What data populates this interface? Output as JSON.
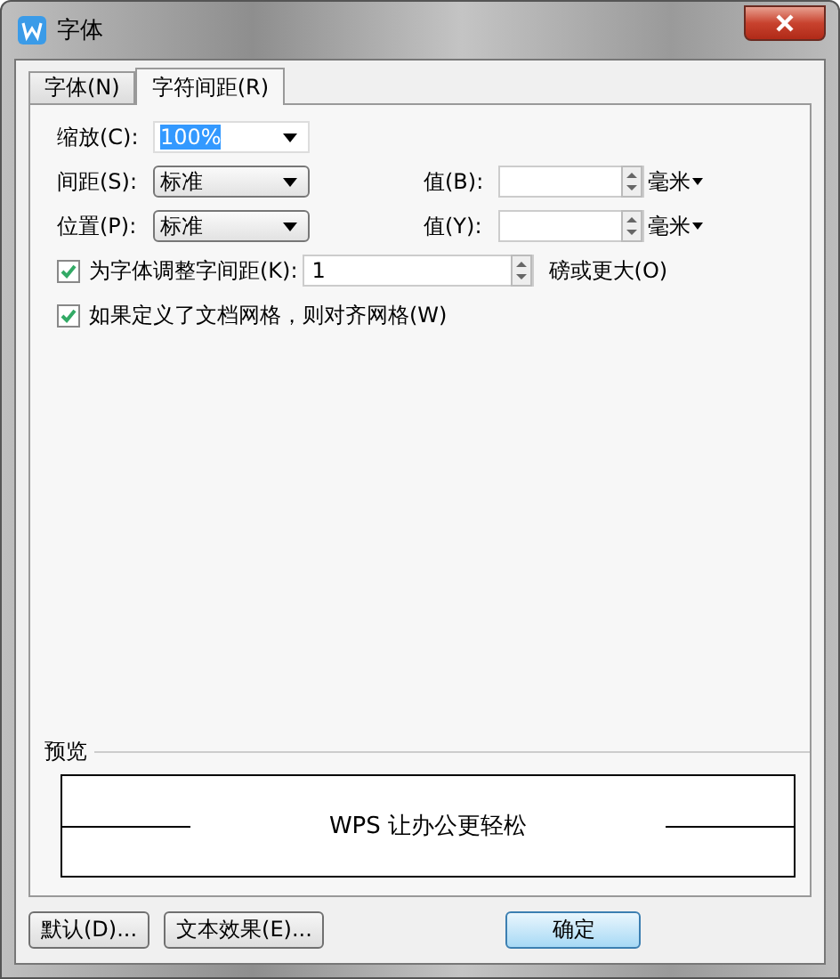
{
  "window": {
    "title": "字体"
  },
  "tabs": [
    {
      "label": "字体(N)",
      "selected": false
    },
    {
      "label": "字符间距(R)",
      "selected": true
    }
  ],
  "scale": {
    "label": "缩放(C):",
    "value": "100%",
    "selected": true
  },
  "spacing": {
    "label": "间距(S):",
    "value": "标准",
    "value_label": "值(B):",
    "unit": "毫米"
  },
  "position": {
    "label": "位置(P):",
    "value": "标准",
    "value_label": "值(Y):",
    "unit": "毫米"
  },
  "kerning": {
    "label": "为字体调整字间距(K):",
    "checked": true,
    "value": "1",
    "suffix": "磅或更大(O)"
  },
  "grid": {
    "label": "如果定义了文档网格，则对齐网格(W)",
    "checked": true
  },
  "preview": {
    "label": "预览",
    "text": "WPS 让办公更轻松"
  },
  "buttons": [
    {
      "label": "默认(D)...",
      "kind": "plain"
    },
    {
      "label": "文本效果(E)...",
      "kind": "plain"
    },
    {
      "label": "确定",
      "kind": "default"
    }
  ]
}
